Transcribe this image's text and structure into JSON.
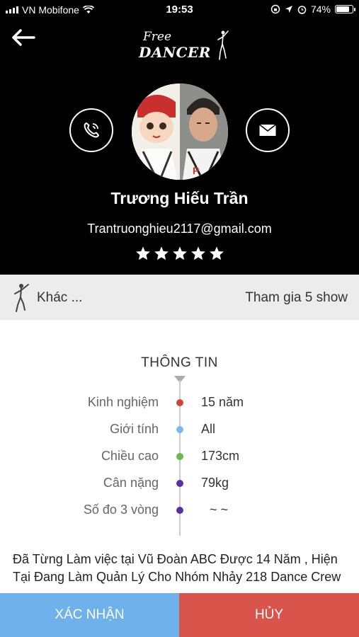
{
  "status_bar": {
    "carrier": "VN Mobifone",
    "time": "19:53",
    "battery": "74%"
  },
  "header": {
    "logo_top": "Free",
    "logo_bottom": "DANCER"
  },
  "profile": {
    "name": "Trương Hiếu Trần",
    "email": "Trantruonghieu2117@gmail.com",
    "rating": 5
  },
  "summary": {
    "category": "Khác ...",
    "shows": "Tham gia 5 show"
  },
  "info": {
    "title": "THÔNG TIN",
    "rows": [
      {
        "label": "Kinh nghiệm",
        "value": "15 năm",
        "color": "#d0453a"
      },
      {
        "label": "Giới tính",
        "value": "All",
        "color": "#7db7ee"
      },
      {
        "label": "Chiều cao",
        "value": "173cm",
        "color": "#6cb84a"
      },
      {
        "label": "Cân nặng",
        "value": "79kg",
        "color": "#5b2fa8"
      },
      {
        "label": "Số đo 3 vòng",
        "value": "~   ~",
        "color": "#5b2fa8"
      }
    ]
  },
  "description": "Đã Từng Làm việc tại Vũ Đoàn ABC Được 14 Năm , Hiện Tại Đang Làm Quản Lý Cho Nhóm Nhảy 218 Dance Crew",
  "actions": {
    "confirm": "XÁC NHẬN",
    "cancel": "HỦY"
  },
  "colors": {
    "confirm_bg": "#6fb1ea",
    "cancel_bg": "#d9544b",
    "header_bg": "#000000"
  },
  "icons": [
    "back-arrow-icon",
    "phone-icon",
    "mail-icon",
    "star-icon",
    "dancer-icon",
    "wifi-icon",
    "location-arrow-icon",
    "alarm-icon",
    "battery-icon"
  ]
}
